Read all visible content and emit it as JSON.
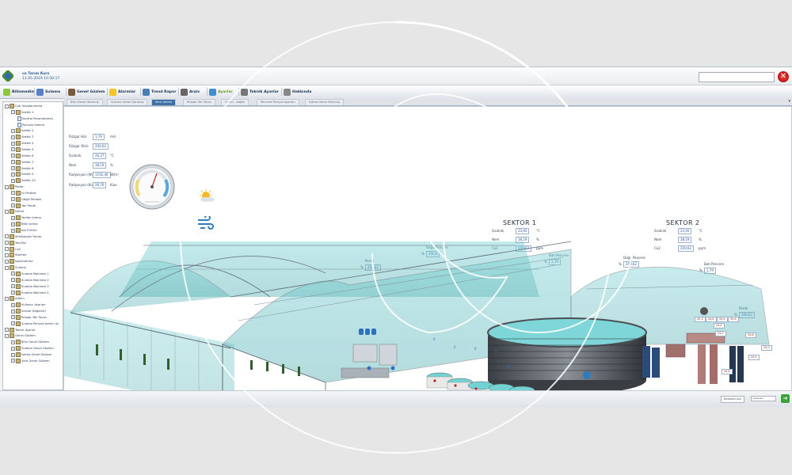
{
  "header": {
    "company_line1": "ca Tarım Kurs",
    "company_line2": "11.05.2019   10:30:17",
    "close_label": "✕"
  },
  "toolbar": [
    {
      "label": "Bilinmedim",
      "icon": "smile-icon",
      "color": "#8fc43d"
    },
    {
      "label": "Sulama",
      "icon": "save-icon",
      "color": "#5b7fc4"
    },
    {
      "label": "Genel Gözlem",
      "icon": "greenhouse-icon",
      "color": "#7a5a3a"
    },
    {
      "label": "Alarmlar",
      "icon": "warning-icon",
      "color": "#f2c623"
    },
    {
      "label": "Trend Rapor",
      "icon": "chart-icon",
      "color": "#4c7fb5"
    },
    {
      "label": "Arşiv",
      "icon": "archive-icon",
      "color": "#666"
    },
    {
      "label": "Ayarlar",
      "icon": "settings-icon",
      "color": "#3d8fd0",
      "active": true
    },
    {
      "label": "Teknik Ayarlar",
      "icon": "tools-icon",
      "color": "#777"
    },
    {
      "label": "Hakkında",
      "icon": "about-icon",
      "color": "#888"
    }
  ],
  "tabs": [
    {
      "label": "Bilin Genel Görünüş"
    },
    {
      "label": "Sulama Genel Görünüş"
    },
    {
      "label": "Sera İzleme",
      "active": true
    },
    {
      "label": "Rüzgar Yön Tavısı"
    },
    {
      "label": "Genel - Sağlık"
    },
    {
      "label": "Pencere Periyod Ayarları"
    },
    {
      "label": "Isıtma Genel Görünüş"
    }
  ],
  "tree": [
    {
      "label": "Çatı Havalandırma",
      "level": 0
    },
    {
      "label": "Sektör 1",
      "level": 1
    },
    {
      "label": "Kontrol Parametreleri",
      "level": 2
    },
    {
      "label": "Pencere İzleme",
      "level": 2
    },
    {
      "label": "Sektör 2",
      "level": 1
    },
    {
      "label": "Sektör 3",
      "level": 1
    },
    {
      "label": "Sektör 4",
      "level": 1
    },
    {
      "label": "Sektör 5",
      "level": 1
    },
    {
      "label": "Sektör 6",
      "level": 1
    },
    {
      "label": "Sektör 7",
      "level": 1
    },
    {
      "label": "Sektör 8",
      "level": 1
    },
    {
      "label": "Sektör 9",
      "level": 1
    },
    {
      "label": "Sektör 10",
      "level": 1
    },
    {
      "label": "Perde",
      "level": 0
    },
    {
      "label": "Isı Perdesi",
      "level": 1
    },
    {
      "label": "Gölge Perdesi",
      "level": 1
    },
    {
      "label": "Yan Perde",
      "level": 1
    },
    {
      "label": "Isıtma",
      "level": 0
    },
    {
      "label": "Yerden Isıtma",
      "level": 1
    },
    {
      "label": "Bitki Isıtma",
      "level": 1
    },
    {
      "label": "Kar Eritme",
      "level": 1
    },
    {
      "label": "Sirkülasyon Fanlar",
      "level": 0
    },
    {
      "label": "Yen/Sisi",
      "level": 0
    },
    {
      "label": "Co2",
      "level": 0
    },
    {
      "label": "Sisleme",
      "level": 0
    },
    {
      "label": "Işıklandırma",
      "level": 0
    },
    {
      "label": "Sulama",
      "level": 0
    },
    {
      "label": "Sulama Makinesi 1",
      "level": 1
    },
    {
      "label": "Sulama Makinesi 2",
      "level": 1
    },
    {
      "label": "Sulama Makinesi 3",
      "level": 1
    },
    {
      "label": "Sulama Makinesi 4",
      "level": 1
    },
    {
      "label": "Admin",
      "level": 0
    },
    {
      "label": "Kullanıcı Ayarları",
      "level": 1
    },
    {
      "label": "Sensör Değerleri",
      "level": 1
    },
    {
      "label": "Rüzgar Yön Tavısı",
      "level": 1
    },
    {
      "label": "Sulama Periyod Admin Ay",
      "level": 1
    },
    {
      "label": "Teknik Ayarlar",
      "level": 0
    },
    {
      "label": "Genel Gözlem",
      "level": 0
    },
    {
      "label": "Bilin Genel Gözlem",
      "level": 1
    },
    {
      "label": "Sulama Genel Gözlem",
      "level": 1
    },
    {
      "label": "Isıtma Genel Gözlem",
      "level": 1
    },
    {
      "label": "Sera Genel Gözlem",
      "level": 1
    }
  ],
  "weather": {
    "rows": [
      {
        "label": "Rüzgar Hızı",
        "value": "1,79",
        "unit": "m/s"
      },
      {
        "label": "Rüzgar Yönü",
        "value": "200,62",
        "unit": ""
      },
      {
        "label": "Sıcaklık",
        "value": "26,27",
        "unit": "°C"
      },
      {
        "label": "Nem",
        "value": "38,19",
        "unit": "%"
      },
      {
        "label": "Radyasyon (W/m²)",
        "value": "1192,46",
        "unit": "W/m²"
      },
      {
        "label": "Radyasyon (Klux)",
        "value": "26,76",
        "unit": "Klux"
      }
    ]
  },
  "sector1": {
    "title": "SEKTOR 1",
    "rows": [
      {
        "label": "Sıcaklık",
        "value": "23,92",
        "unit": "°C"
      },
      {
        "label": "Nem",
        "value": "38,19",
        "unit": "%"
      },
      {
        "label": "Co2",
        "value": "200,62",
        "unit": "ppm"
      }
    ],
    "east_window": {
      "label": "Doğu Pencere",
      "prefix": "%",
      "value": "200,6"
    },
    "west_window": {
      "label": "Batı Pencere",
      "prefix": "%",
      "value": "1,79"
    },
    "curtain": {
      "label": "Perde",
      "prefix": "%",
      "value": "200,62"
    }
  },
  "sector2": {
    "title": "SEKTOR 2",
    "rows": [
      {
        "label": "Sıcaklık",
        "value": "23,92",
        "unit": "°C"
      },
      {
        "label": "Nem",
        "value": "38,19",
        "unit": "%"
      },
      {
        "label": "Co2",
        "value": "200,62",
        "unit": "ppm"
      }
    ],
    "east_window": {
      "label": "Doğu Pencere",
      "prefix": "%",
      "value": "200,62"
    },
    "west_window": {
      "label": "Batı Pencere",
      "prefix": "%",
      "value": "1,79"
    },
    "curtain": {
      "label": "Perde",
      "prefix": "%",
      "value": "200,62"
    }
  },
  "tanks": {
    "labels": [
      "0",
      "0",
      "0",
      "0",
      "10"
    ]
  },
  "boiler_tags": [
    "45,3",
    "44,8",
    "35,6",
    "35,6",
    "24,4",
    "24,0",
    "24,8",
    "24,0",
    "24,0",
    "24,8"
  ],
  "status": {
    "user_label": "Kullanıcı Adı",
    "password_mask": "*******",
    "exit_label": "➜"
  },
  "colors": {
    "accent": "#3d6ea6",
    "glass": "#5fc1c3",
    "value_text": "#2b59a8"
  }
}
